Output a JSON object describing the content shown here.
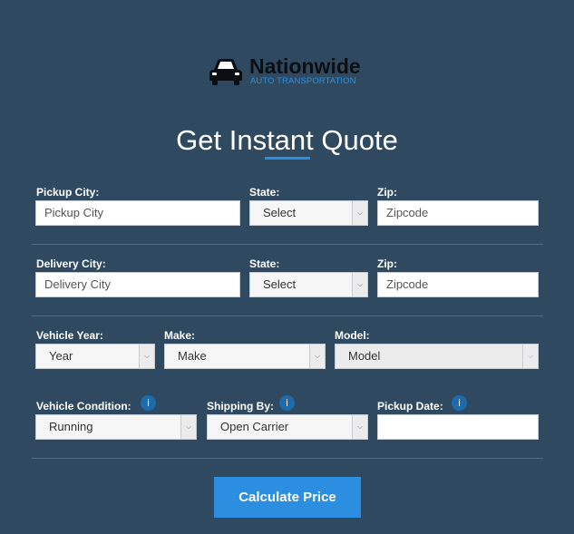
{
  "brand": {
    "name": "Nationwide",
    "tagline": "AUTO TRANSPORTATION"
  },
  "title": "Get Instant Quote",
  "pickup": {
    "city_label": "Pickup City:",
    "city_placeholder": "Pickup City",
    "state_label": "State:",
    "state_value": "Select",
    "zip_label": "Zip:",
    "zip_placeholder": "Zipcode"
  },
  "delivery": {
    "city_label": "Delivery City:",
    "city_placeholder": "Delivery City",
    "state_label": "State:",
    "state_value": "Select",
    "zip_label": "Zip:",
    "zip_placeholder": "Zipcode"
  },
  "vehicle": {
    "year_label": "Vehicle Year:",
    "year_value": "Year",
    "make_label": "Make:",
    "make_value": "Make",
    "model_label": "Model:",
    "model_value": "Model"
  },
  "shipping": {
    "condition_label": "Vehicle Condition:",
    "condition_value": "Running",
    "shipping_label": "Shipping By:",
    "shipping_value": "Open Carrier",
    "date_label": "Pickup Date:",
    "date_value": "",
    "info_glyph": "i"
  },
  "button": {
    "label": "Calculate Price"
  },
  "colors": {
    "background": "#2f4a60",
    "accent": "#2b8ee0",
    "info_badge": "#1e6bab"
  }
}
